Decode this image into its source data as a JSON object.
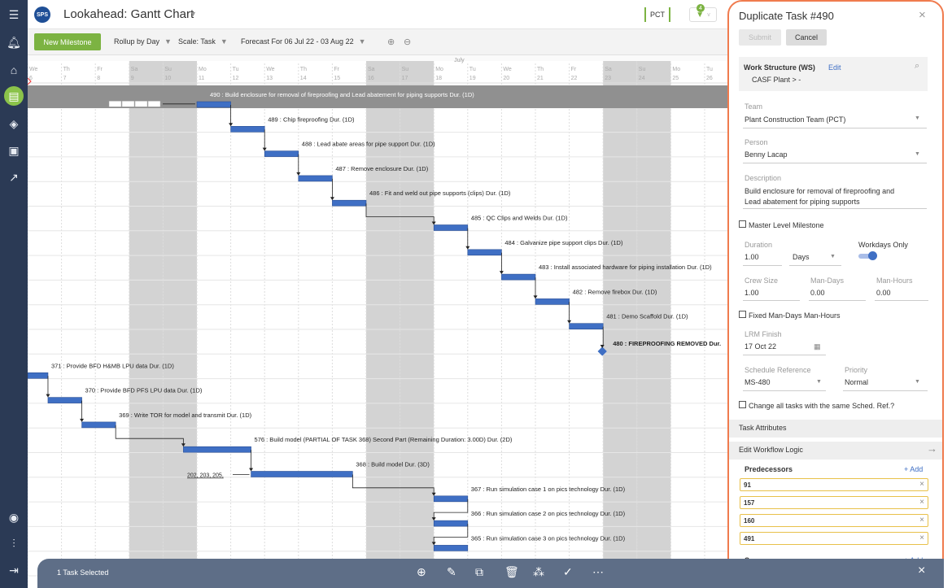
{
  "app": {
    "logo_text": "SPS",
    "title": "Lookahead: Gantt Chart",
    "team_short": "PCT",
    "filter_badge": "4"
  },
  "toolbar": {
    "new_milestone": "New Milestone",
    "rollup": "Rollup by Day",
    "scale": "Scale: Task",
    "forecast": "Forecast For 06 Jul 22 - 03 Aug 22"
  },
  "timeline": {
    "month": "July",
    "days": [
      {
        "dow": "We",
        "date": "6"
      },
      {
        "dow": "Th",
        "date": "7"
      },
      {
        "dow": "Fr",
        "date": "8"
      },
      {
        "dow": "Sa",
        "date": "9"
      },
      {
        "dow": "Su",
        "date": "10"
      },
      {
        "dow": "Mo",
        "date": "11"
      },
      {
        "dow": "Tu",
        "date": "12"
      },
      {
        "dow": "We",
        "date": "13"
      },
      {
        "dow": "Th",
        "date": "14"
      },
      {
        "dow": "Fr",
        "date": "15"
      },
      {
        "dow": "Sa",
        "date": "16"
      },
      {
        "dow": "Su",
        "date": "17"
      },
      {
        "dow": "Mo",
        "date": "18"
      },
      {
        "dow": "Tu",
        "date": "19"
      },
      {
        "dow": "We",
        "date": "20"
      },
      {
        "dow": "Th",
        "date": "21"
      },
      {
        "dow": "Fr",
        "date": "22"
      },
      {
        "dow": "Sa",
        "date": "23"
      },
      {
        "dow": "Su",
        "date": "24"
      },
      {
        "dow": "Mo",
        "date": "25"
      },
      {
        "dow": "Tu",
        "date": "26"
      }
    ]
  },
  "tasks": [
    {
      "label": "490 : Build enclosure for removal of fireproofing and Lead abatement for piping supports Dur. (1D)",
      "day": 5,
      "dur": 1,
      "row": 1,
      "selected": true
    },
    {
      "label": "489 : Chip fireproofing Dur. (1D)",
      "day": 6,
      "dur": 1,
      "row": 2
    },
    {
      "label": "488 : Lead abate areas for pipe support Dur. (1D)",
      "day": 7,
      "dur": 1,
      "row": 3
    },
    {
      "label": "487 : Remove enclosure Dur. (1D)",
      "day": 8,
      "dur": 1,
      "row": 4
    },
    {
      "label": "486 : Fit and weld out pipe supports (clips) Dur. (1D)",
      "day": 9,
      "dur": 1,
      "row": 5
    },
    {
      "label": "485 : QC Clips and Welds Dur. (1D)",
      "day": 12,
      "dur": 1,
      "row": 6
    },
    {
      "label": "484 : Galvanize pipe support clips Dur. (1D)",
      "day": 13,
      "dur": 1,
      "row": 7
    },
    {
      "label": "483 : Install associated hardware for piping installation Dur. (1D)",
      "day": 14,
      "dur": 1,
      "row": 8
    },
    {
      "label": "482 : Remove firebox Dur. (1D)",
      "day": 15,
      "dur": 1,
      "row": 9
    },
    {
      "label": "481 : Demo Scaffold Dur. (1D)",
      "day": 16,
      "dur": 1,
      "row": 10
    },
    {
      "label": "480 : FIREPROOFING REMOVED Dur.",
      "day": 17,
      "dur": 0,
      "row": 11,
      "milestone": true
    },
    {
      "label": "371 : Provide BFD H&MB LPU data Dur. (1D)",
      "day": 0,
      "dur": 0.6,
      "row": 12
    },
    {
      "label": "370 : Provide BFD PFS LPU data Dur. (1D)",
      "day": 0.6,
      "dur": 1,
      "row": 13
    },
    {
      "label": "369 : Write TOR for model and transmit Dur. (1D)",
      "day": 1.6,
      "dur": 1,
      "row": 14
    },
    {
      "label": "576 : Build model (PARTIAL OF TASK 368) Second Part (Remaining Duration: 3.00D) Dur. (2D)",
      "day": 4.6,
      "dur": 2,
      "row": 15
    },
    {
      "label": "368 : Build model Dur. (3D)",
      "day": 6.6,
      "dur": 3,
      "row": 16
    },
    {
      "label": "367 : Run simulation case 1 on pics technology Dur. (1D)",
      "day": 12,
      "dur": 1,
      "row": 17
    },
    {
      "label": "366 : Run simulation case 2 on pics technology Dur. (1D)",
      "day": 12,
      "dur": 1,
      "row": 18
    },
    {
      "label": "365 : Run simulation case 3 on pics technology Dur. (1D)",
      "day": 12,
      "dur": 1,
      "row": 19
    }
  ],
  "pred_note": "202, 203, 205,",
  "panel": {
    "title": "Duplicate Task #490",
    "submit": "Submit",
    "cancel": "Cancel",
    "ws_label": "Work Structure (WS)",
    "ws_edit": "Edit",
    "ws_value": "CASF Plant  >  -",
    "team_label": "Team",
    "team_value": "Plant Construction Team (PCT)",
    "person_label": "Person",
    "person_value": "Benny Lacap",
    "desc_label": "Description",
    "desc_value": "Build enclosure for removal of fireproofing and Lead abatement for piping supports",
    "master_ms": "Master Level Milestone",
    "duration_label": "Duration",
    "duration_value": "1.00",
    "duration_unit": "Days",
    "workdays_label": "Workdays Only",
    "crew_label": "Crew Size",
    "crew_value": "1.00",
    "mandays_label": "Man-Days",
    "mandays_value": "0.00",
    "manhours_label": "Man-Hours",
    "manhours_value": "0.00",
    "fixed_label": "Fixed Man-Days Man-Hours",
    "lrm_label": "LRM Finish",
    "lrm_value": "17 Oct 22",
    "schedref_label": "Schedule Reference",
    "schedref_value": "MS-480",
    "priority_label": "Priority",
    "priority_value": "Normal",
    "change_all": "Change all tasks with the same Sched. Ref.?",
    "task_attr": "Task Attributes",
    "edit_wf": "Edit Workflow Logic",
    "pred_title": "Predecessors",
    "pred_add": "+ Add",
    "predecessors": [
      "91",
      "157",
      "160",
      "491"
    ],
    "succ_title": "Successors",
    "succ_add": "+ Add"
  },
  "bottom": {
    "selected": "1 Task Selected"
  },
  "colors": {
    "sidebar": "#2b3a55",
    "accent": "#7cb342",
    "bar": "#3f6fc4",
    "weekend": "#d3d3d3",
    "panel_border": "#f07b4e"
  }
}
